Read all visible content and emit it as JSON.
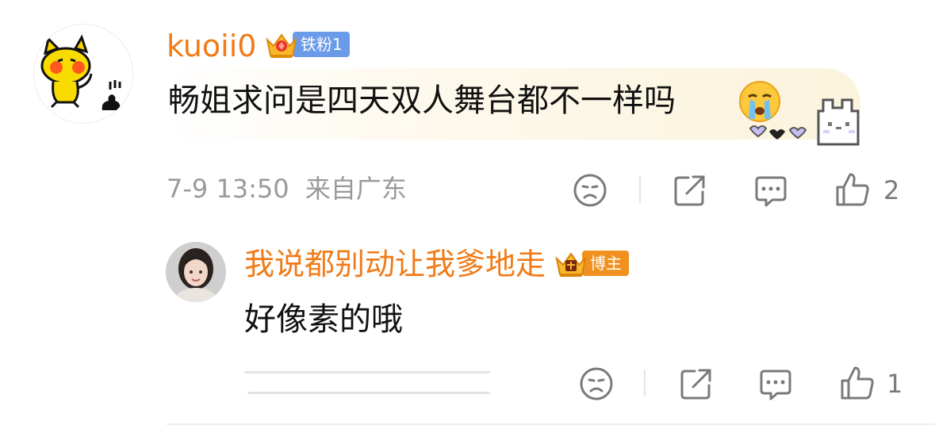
{
  "comment": {
    "username": "kuoii0",
    "badge_label": "铁粉1",
    "text": "畅姐求问是四天双人舞台都不一样吗",
    "emoji_icon": "crying-face-icon",
    "timestamp": "7-9 13:50",
    "location": "来自广东",
    "like_count": "2"
  },
  "reply": {
    "username": "我说都别动让我爹地走",
    "badge_label": "博主",
    "text": "好像素的哦",
    "like_count": "1"
  },
  "colors": {
    "username": "#f07b18",
    "fan_badge": "#6a9be8",
    "blogger_badge": "#f0901e",
    "text": "#111111",
    "meta": "#9a9a9a"
  },
  "icons": [
    "dislike-face-icon",
    "share-icon",
    "comment-icon",
    "like-icon"
  ]
}
